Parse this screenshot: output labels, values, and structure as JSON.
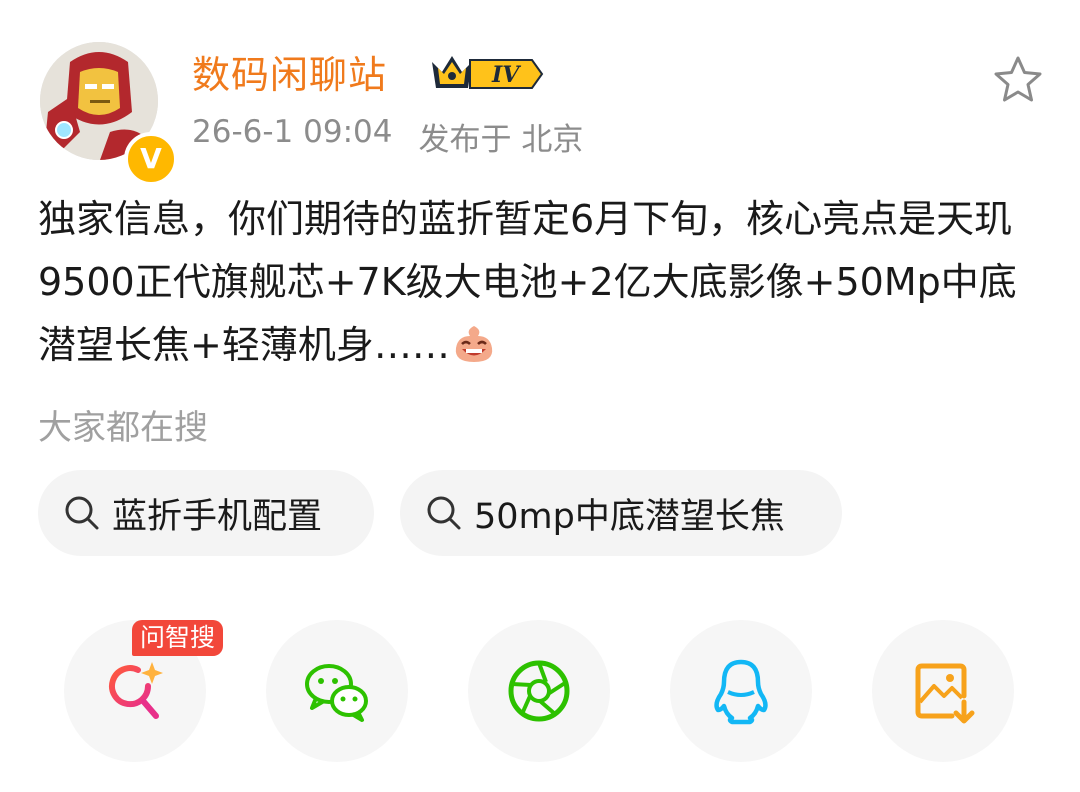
{
  "post": {
    "author": {
      "username": "数码闲聊站",
      "rank_badge": "IV",
      "verified_badge": "V"
    },
    "timestamp": "26-6-1 09:04",
    "location": "发布于 北京",
    "text": "独家信息，你们期待的蓝折暂定6月下旬，核心亮点是天玑9500正代旗舰芯+7K级大电池+2亿大底影像+50Mp中底潜望长焦+轻薄机身……",
    "emoji_icon": "laughing-emoji-icon"
  },
  "search": {
    "heading": "大家都在搜",
    "chips": [
      {
        "label": "蓝折手机配置",
        "icon": "search-icon"
      },
      {
        "label": "50mp中底潜望长焦",
        "icon": "search-icon"
      }
    ]
  },
  "share_bar": {
    "ai_search_tag": "问智搜",
    "buttons": [
      {
        "name": "ai-search",
        "icon": "sparkle-search-icon"
      },
      {
        "name": "wechat",
        "icon": "wechat-icon"
      },
      {
        "name": "moments",
        "icon": "camera-shutter-icon"
      },
      {
        "name": "qq",
        "icon": "qq-penguin-icon"
      },
      {
        "name": "save-image",
        "icon": "image-download-icon"
      }
    ]
  },
  "colors": {
    "username": "#f07a1c",
    "meta_text": "#8c8c8c",
    "chip_bg": "#f4f4f4",
    "ai_tag": "#f2473a",
    "wechat": "#2dc100",
    "qq": "#12b7f5",
    "save": "#f7a21b"
  }
}
